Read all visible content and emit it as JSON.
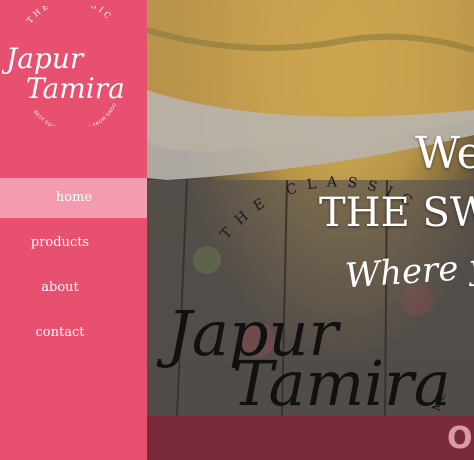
{
  "logo": {
    "ring_top": "THE CLASSIC",
    "script_line1": "Japur",
    "script_line2": "Tamira",
    "ring_bottom": "BEST SOUVENIR & FOOD FROM GADO"
  },
  "nav": {
    "items": [
      {
        "label": "home",
        "active": true
      },
      {
        "label": "products",
        "active": false
      },
      {
        "label": "about",
        "active": false
      },
      {
        "label": "contact",
        "active": false
      }
    ]
  },
  "hero": {
    "welcome": "We",
    "shop_name": "THE SW",
    "tagline": "Where you",
    "watermark_ring": "THE CLASSIC",
    "watermark_script1": "Japur",
    "watermark_script2": "Tamira",
    "watermark_tail": "ME"
  },
  "bottom": {
    "text": "Or"
  },
  "colors": {
    "sidebar": "#e8506f",
    "active_nav": "#f59bb0",
    "bottom_bar": "#7a2a3c"
  }
}
